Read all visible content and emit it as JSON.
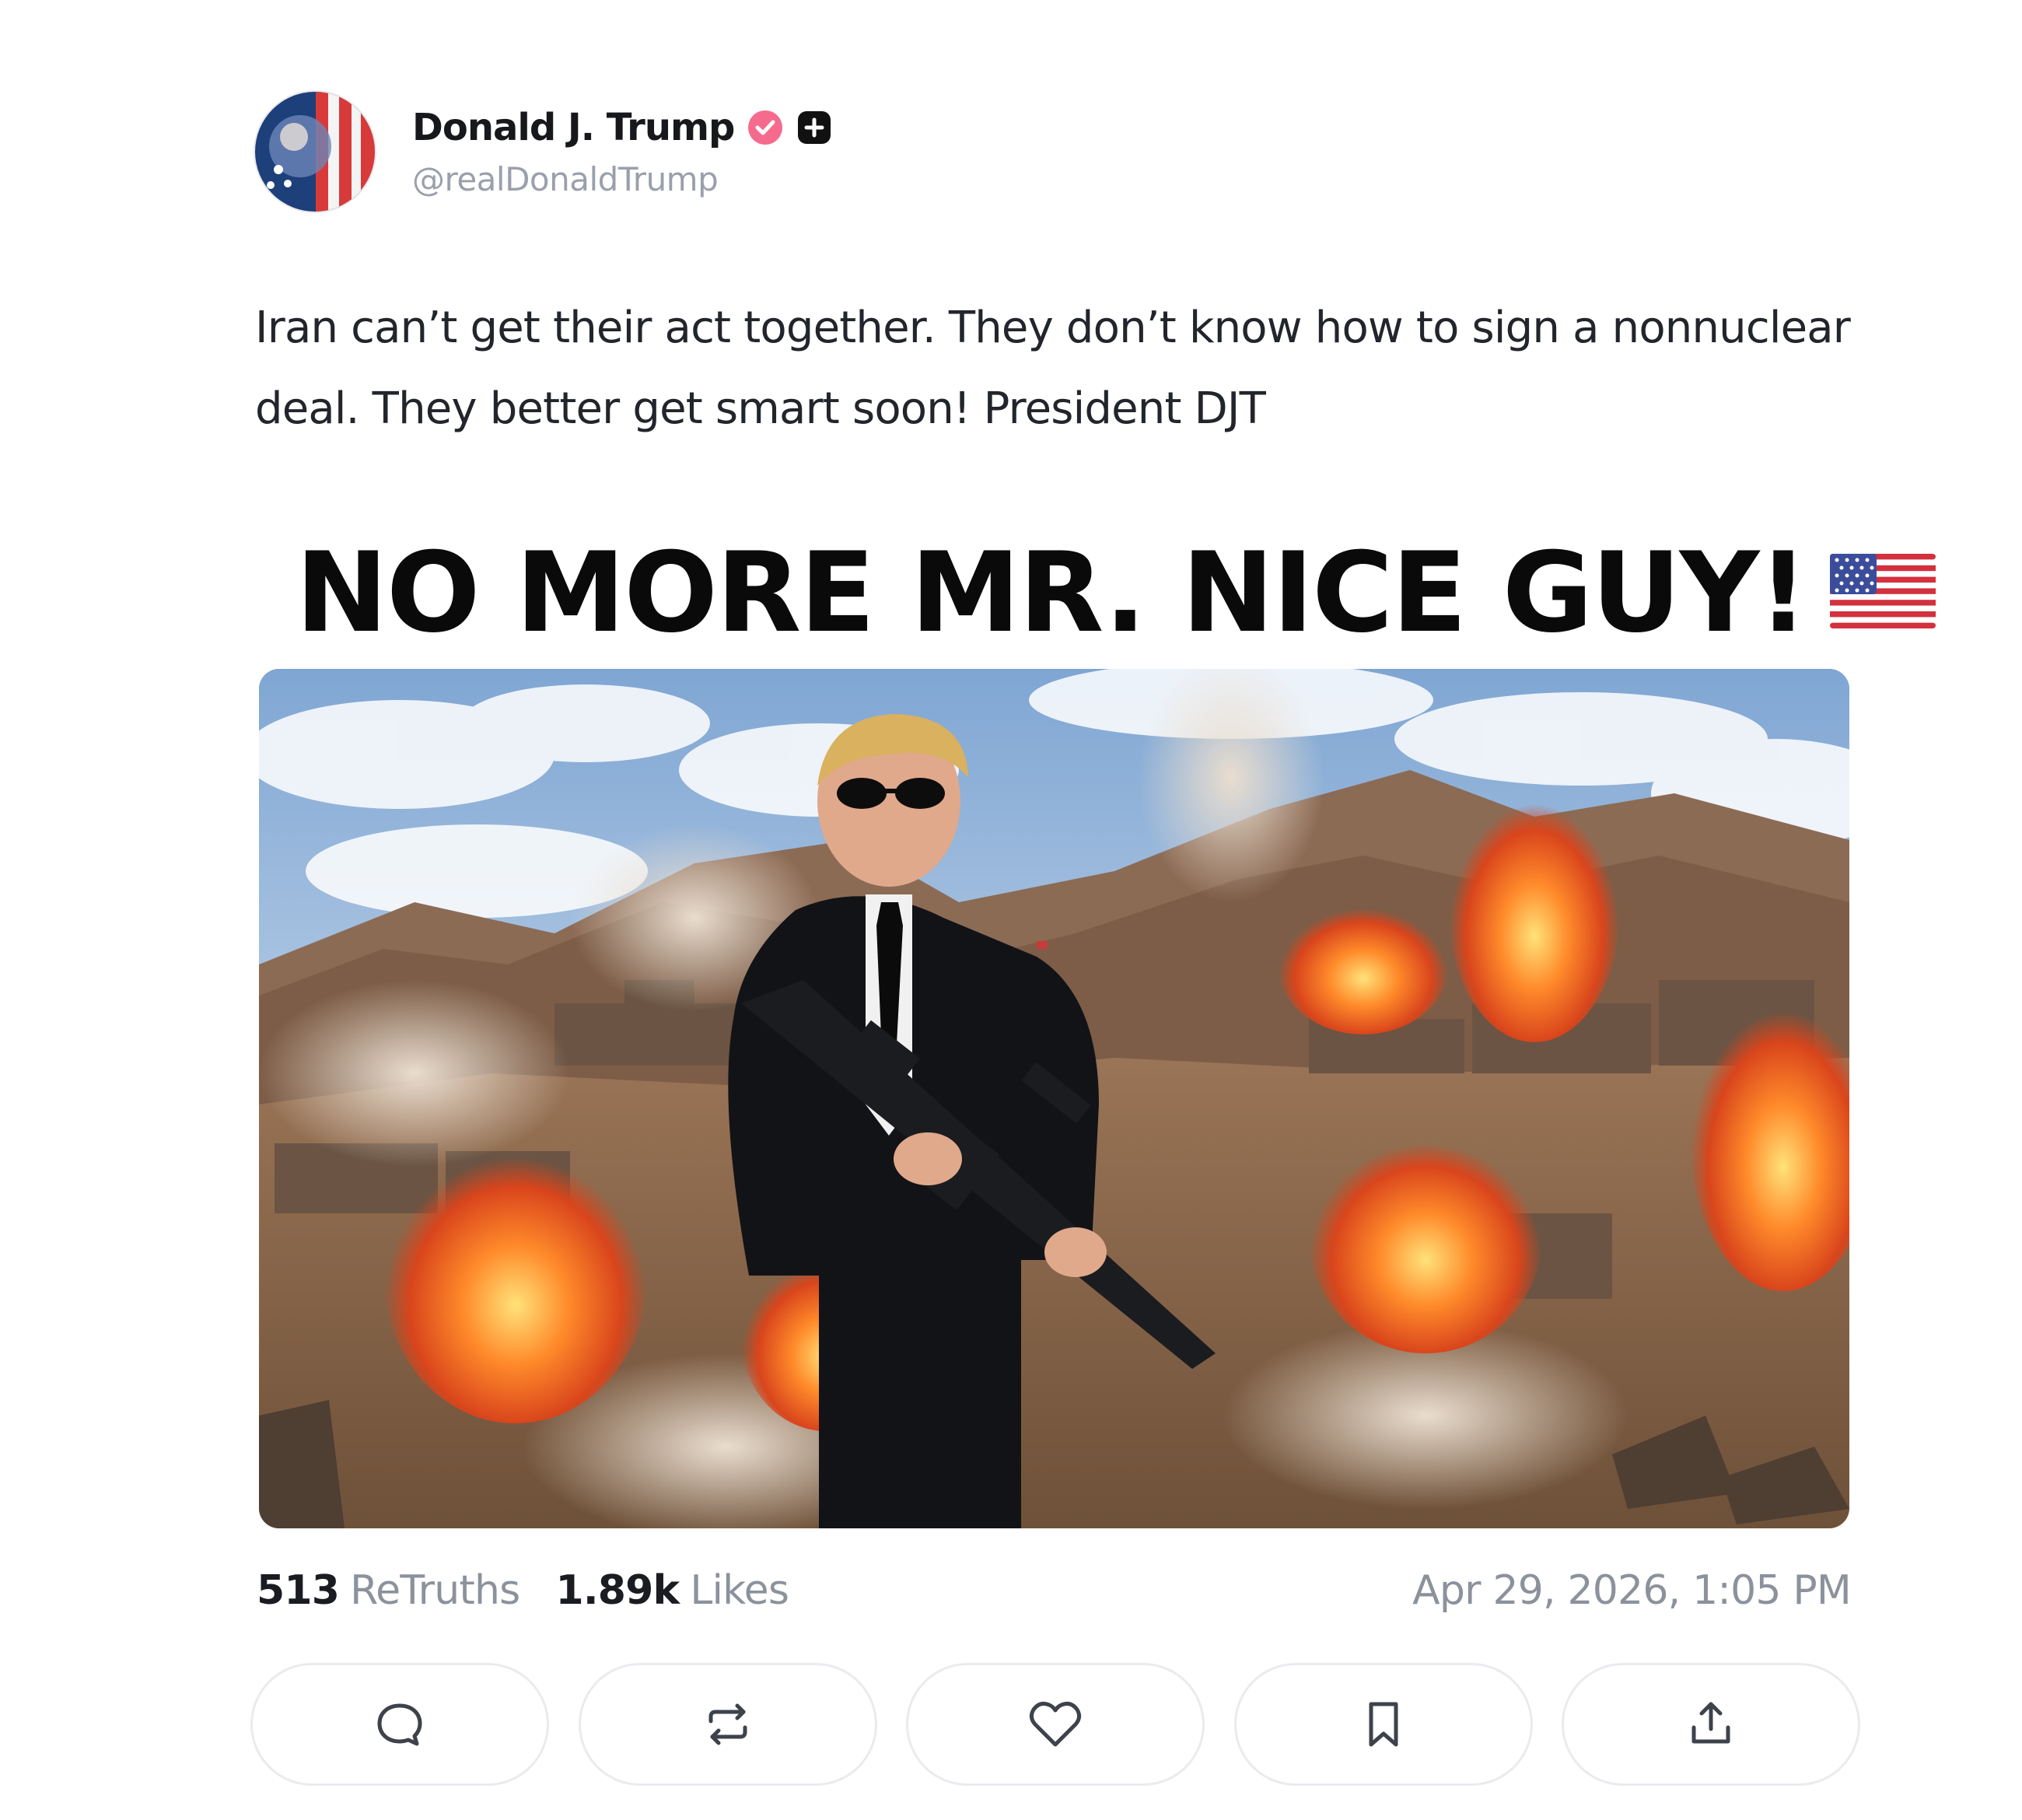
{
  "post": {
    "author": {
      "display_name": "Donald J. Trump",
      "handle": "@realDonaldTrump",
      "verified_badge": "verified-check-icon",
      "extra_badge": "plus-icon"
    },
    "text": "Iran can’t get their act together. They don’t know how to sign a nonnuclear deal. They better get smart soon! President DJT",
    "media": {
      "headline": "NO MORE MR. NICE GUY!",
      "headline_emoji": "us-flag-icon"
    },
    "stats": {
      "retruths_value": "513",
      "retruths_label": "ReTruths",
      "likes_value": "1.89k",
      "likes_label": "Likes",
      "timestamp": "Apr 29, 2026, 1:05 PM"
    },
    "actions": [
      {
        "icon": "reply-icon"
      },
      {
        "icon": "retruth-icon"
      },
      {
        "icon": "like-icon"
      },
      {
        "icon": "bookmark-icon"
      },
      {
        "icon": "share-icon"
      }
    ]
  },
  "colors": {
    "verified_badge": "#f56b8d",
    "extra_badge": "#111111",
    "muted_text": "#8c929c",
    "button_border": "#e9ebef"
  }
}
